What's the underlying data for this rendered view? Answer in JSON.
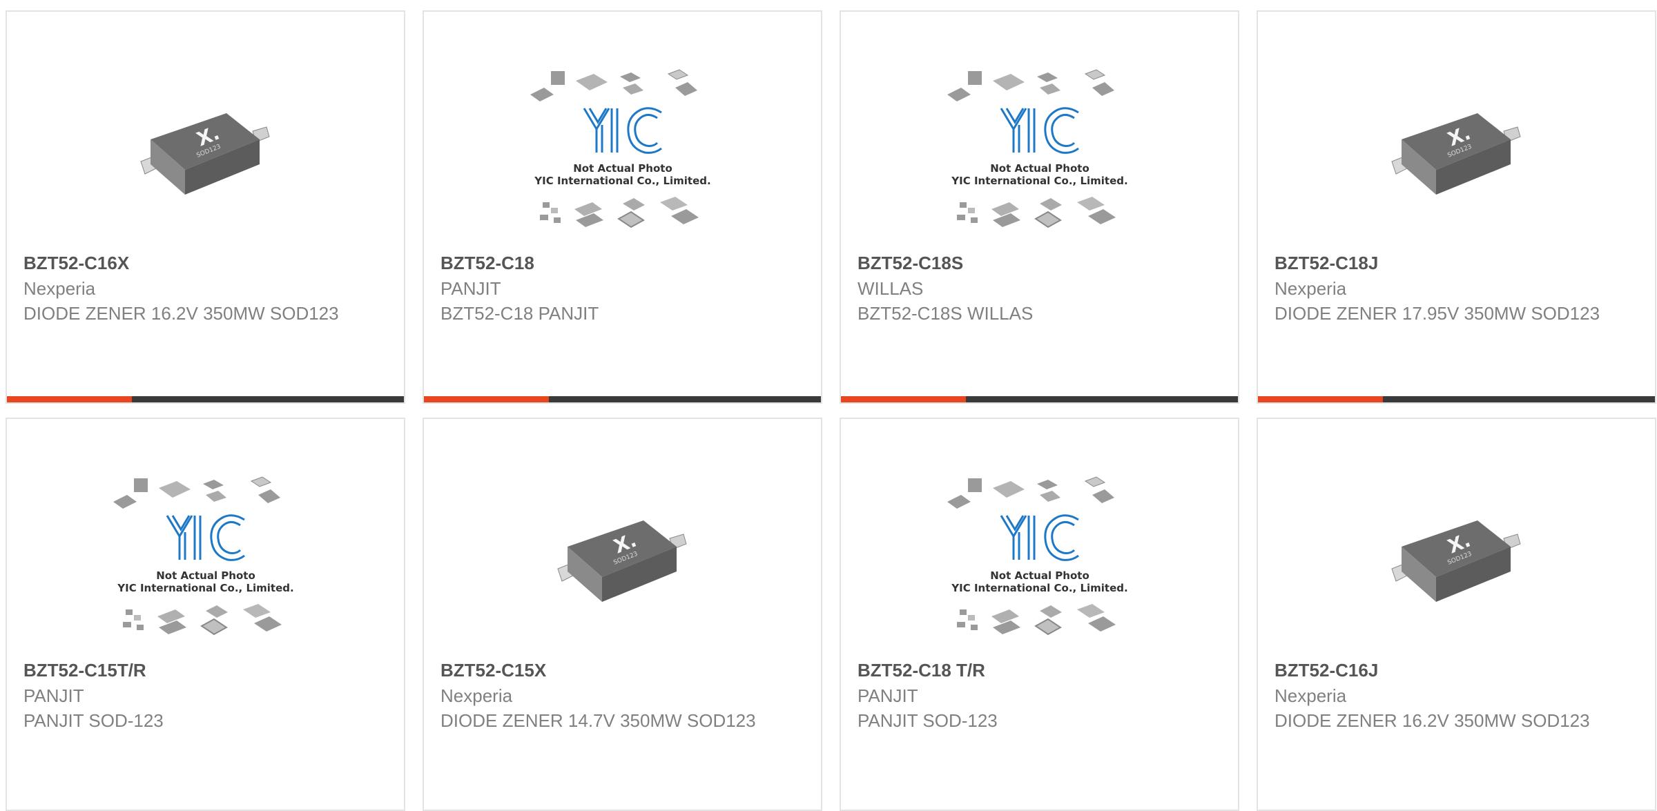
{
  "products": [
    {
      "part": "BZT52-C16X",
      "maker": "Nexperia",
      "description": "DIODE ZENER 16.2V 350MW SOD123",
      "image": "nexperia-sod123-diode",
      "image_label": "SOD123"
    },
    {
      "part": "BZT52-C18",
      "maker": "PANJIT",
      "description": "BZT52-C18 PANJIT",
      "image": "yic-placeholder",
      "image_caption_1": "Not Actual Photo",
      "image_caption_2": "YIC International Co., Limited."
    },
    {
      "part": "BZT52-C18S",
      "maker": "WILLAS",
      "description": "BZT52-C18S WILLAS",
      "image": "yic-placeholder",
      "image_caption_1": "Not Actual Photo",
      "image_caption_2": "YIC International Co., Limited."
    },
    {
      "part": "BZT52-C18J",
      "maker": "Nexperia",
      "description": "DIODE ZENER 17.95V 350MW SOD123",
      "image": "nexperia-sod123-diode",
      "image_label": "SOD123"
    },
    {
      "part": "BZT52-C15T/R",
      "maker": "PANJIT",
      "description": "PANJIT SOD-123",
      "image": "yic-placeholder",
      "image_caption_1": "Not Actual Photo",
      "image_caption_2": "YIC International Co., Limited."
    },
    {
      "part": "BZT52-C15X",
      "maker": "Nexperia",
      "description": "DIODE ZENER 14.7V 350MW SOD123",
      "image": "nexperia-sod123-diode",
      "image_label": "SOD123"
    },
    {
      "part": "BZT52-C18 T/R",
      "maker": "PANJIT",
      "description": "PANJIT SOD-123",
      "image": "yic-placeholder",
      "image_caption_1": "Not Actual Photo",
      "image_caption_2": "YIC International Co., Limited."
    },
    {
      "part": "BZT52-C16J",
      "maker": "Nexperia",
      "description": "DIODE ZENER 16.2V 350MW SOD123",
      "image": "nexperia-sod123-diode",
      "image_label": "SOD123"
    }
  ],
  "colors": {
    "accent": "#e8461e",
    "bar": "#3a3a3a",
    "yic_blue": "#1e78c8",
    "border": "#e3e3e3"
  },
  "icons": {
    "nexperia": "nexperia-x-logo",
    "yic": "yic-logo"
  }
}
